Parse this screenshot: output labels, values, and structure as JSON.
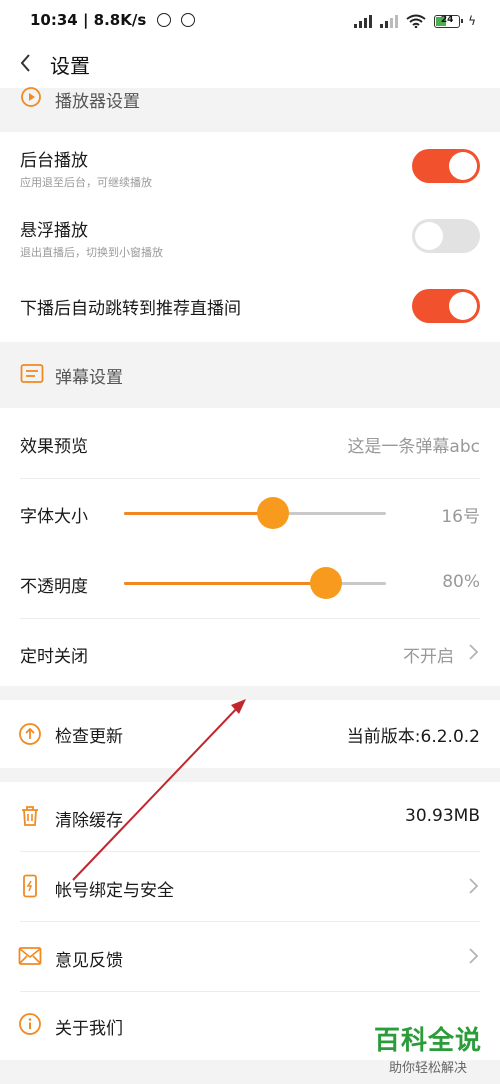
{
  "status_bar": {
    "time_speed": "10:34 | 8.8K/s",
    "battery": "24"
  },
  "header": {
    "title": "设置"
  },
  "player_section": {
    "header": "播放器设置",
    "rows": [
      {
        "label": "后台播放",
        "sub": "应用退至后台，可继续播放",
        "toggle": "on"
      },
      {
        "label": "悬浮播放",
        "sub": "退出直播后，切换到小窗播放",
        "toggle": "off"
      },
      {
        "label": "下播后自动跳转到推荐直播间",
        "toggle": "on"
      }
    ]
  },
  "danmaku_section": {
    "header": "弹幕设置",
    "preview": {
      "label": "效果预览",
      "value": "这是一条弹幕abc"
    },
    "font_size": {
      "label": "字体大小",
      "value": "16号",
      "level": 0.57
    },
    "opacity": {
      "label": "不透明度",
      "value": "80%",
      "level": 0.77
    },
    "timer": {
      "label": "定时关闭",
      "value": "不开启"
    }
  },
  "update": {
    "label": "检查更新",
    "value": "当前版本:6.2.0.2"
  },
  "misc": {
    "clear_cache": {
      "label": "清除缓存",
      "value": "30.93MB"
    },
    "account": {
      "label": "帐号绑定与安全"
    },
    "feedback": {
      "label": "意见反馈"
    },
    "about": {
      "label": "关于我们"
    }
  },
  "watermark": {
    "title": "百科全说",
    "subtitle": "助你轻松解决"
  },
  "colors": {
    "accent": "#f2512d",
    "slider": "#f2871f",
    "icon": "#f08a24"
  }
}
